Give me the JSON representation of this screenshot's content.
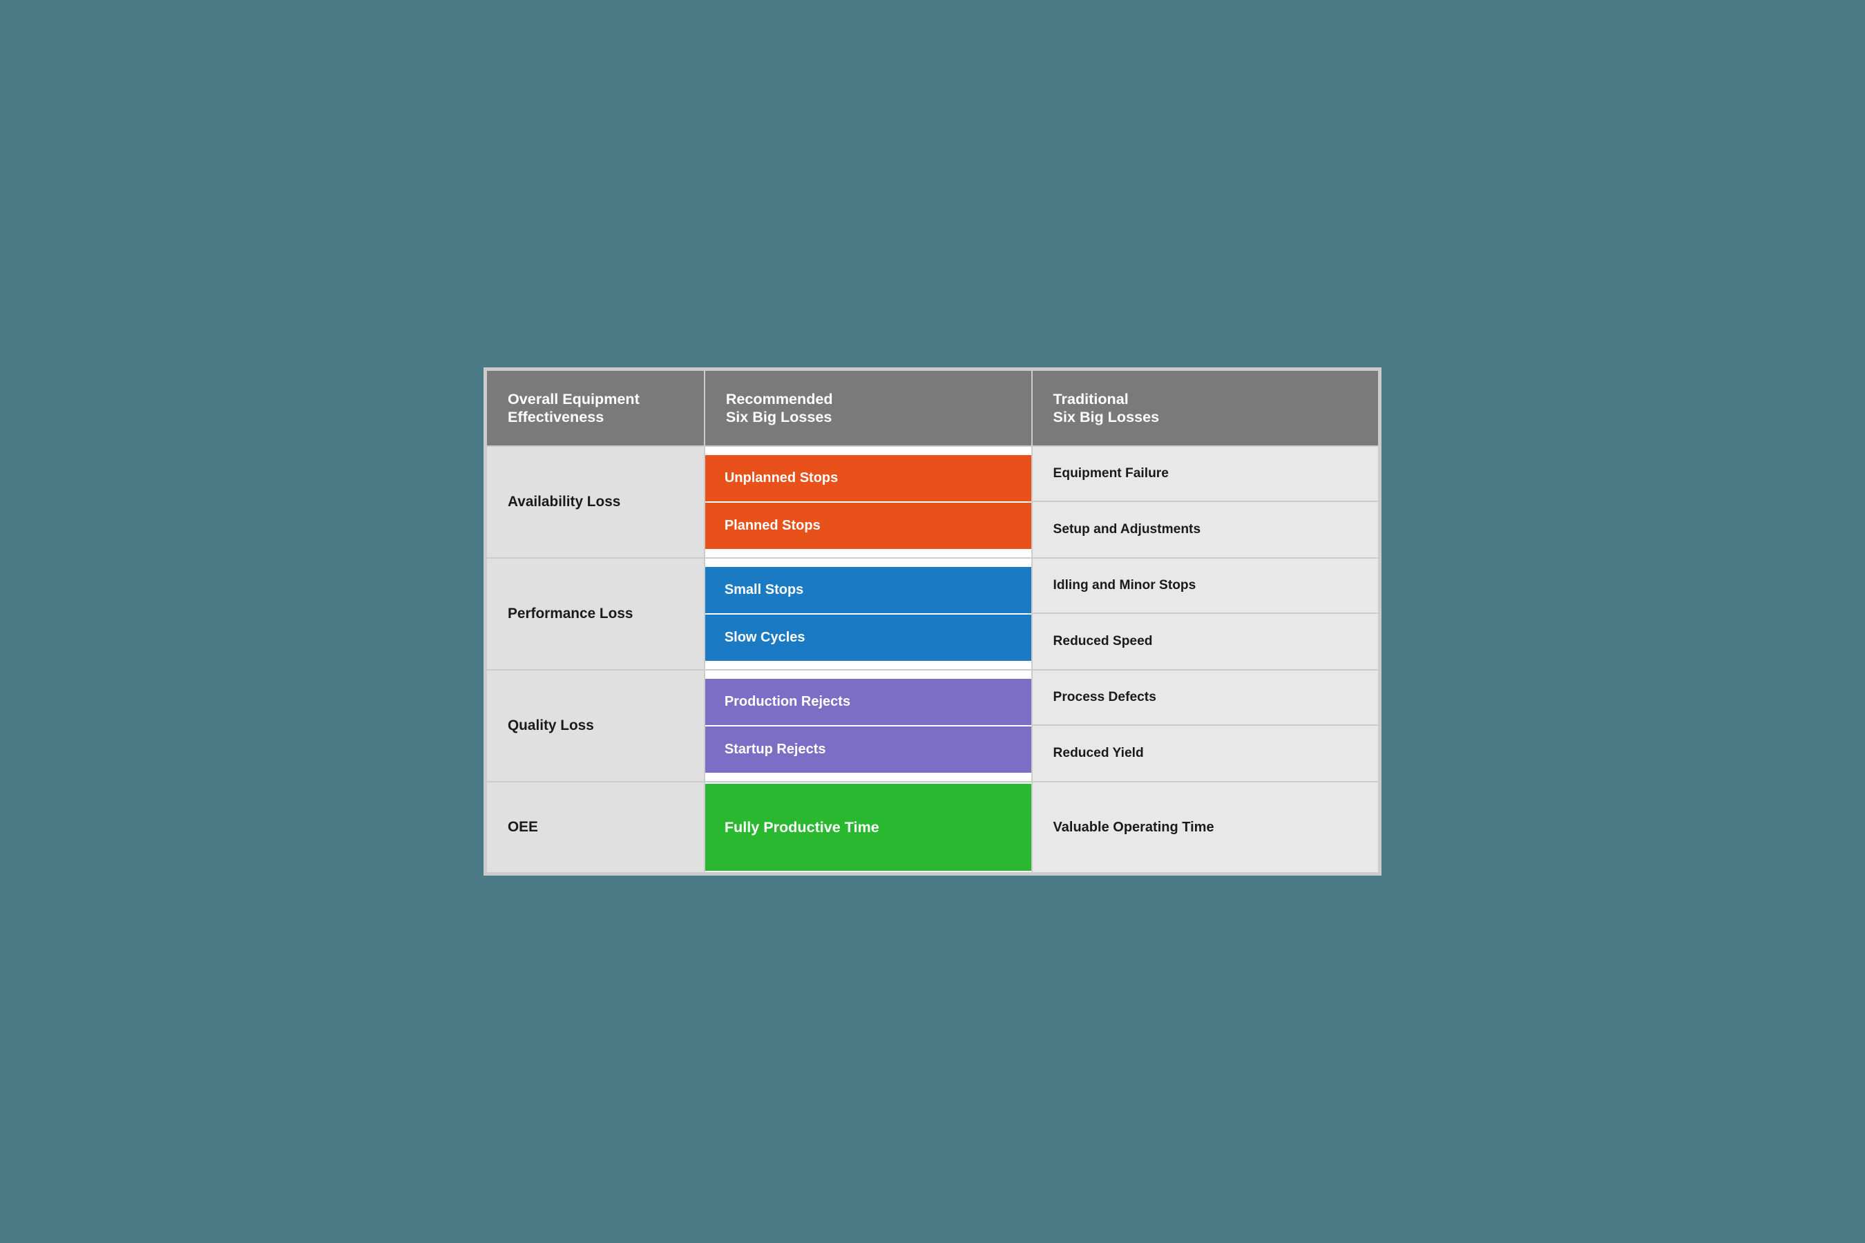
{
  "headers": {
    "col1": "Overall Equipment\nEffectiveness",
    "col2": "Recommended\nSix Big Losses",
    "col3": "Traditional\nSix Big Losses"
  },
  "rows": [
    {
      "category": "Availability Loss",
      "losses": [
        {
          "label": "Unplanned Stops",
          "color": "orange"
        },
        {
          "label": "Planned Stops",
          "color": "orange"
        }
      ],
      "traditional": [
        {
          "label": "Equipment Failure"
        },
        {
          "label": "Setup and Adjustments"
        }
      ]
    },
    {
      "category": "Performance Loss",
      "losses": [
        {
          "label": "Small Stops",
          "color": "blue"
        },
        {
          "label": "Slow Cycles",
          "color": "blue"
        }
      ],
      "traditional": [
        {
          "label": "Idling and Minor Stops"
        },
        {
          "label": "Reduced Speed"
        }
      ]
    },
    {
      "category": "Quality Loss",
      "losses": [
        {
          "label": "Production Rejects",
          "color": "purple"
        },
        {
          "label": "Startup Rejects",
          "color": "purple"
        }
      ],
      "traditional": [
        {
          "label": "Process Defects"
        },
        {
          "label": "Reduced Yield"
        }
      ]
    },
    {
      "category": "OEE",
      "losses": [
        {
          "label": "Fully Productive Time",
          "color": "green"
        }
      ],
      "traditional": [
        {
          "label": "Valuable Operating Time"
        }
      ]
    }
  ]
}
